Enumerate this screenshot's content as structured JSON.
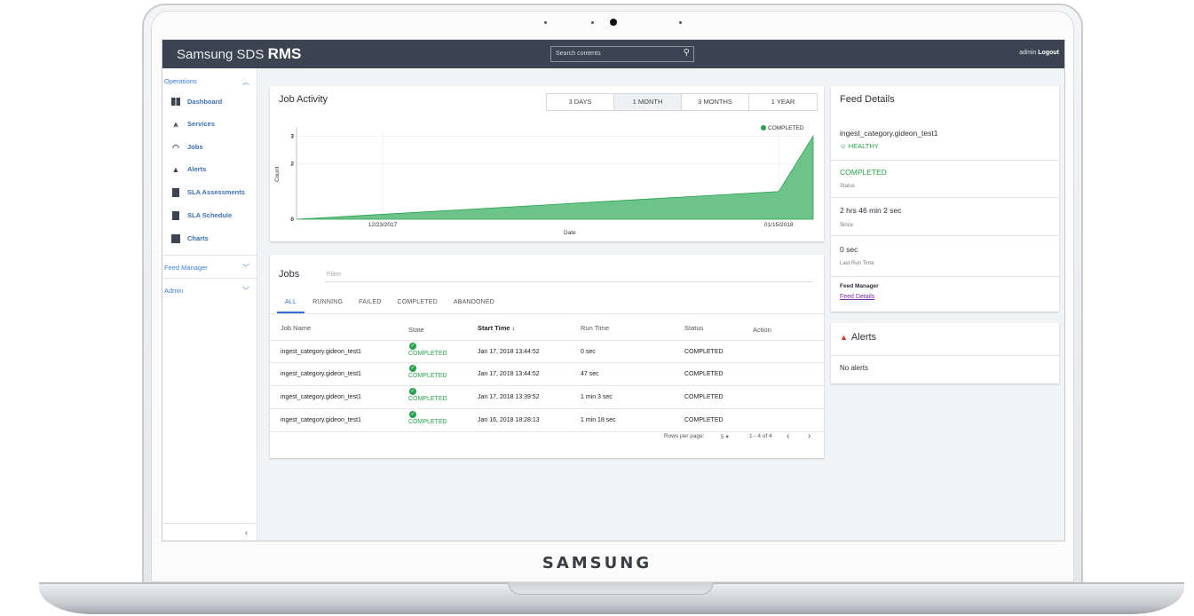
{
  "device": {
    "brand": "SAMSUNG"
  },
  "header": {
    "logo_prefix": "Samsung SDS",
    "logo_main": "RMS",
    "search_placeholder": "Search contents",
    "user": "admin",
    "logout_label": "Logout"
  },
  "sidebar": {
    "operations_label": "Operations",
    "items": [
      {
        "label": "Dashboard",
        "icon": "dashboard-icon"
      },
      {
        "label": "Services",
        "icon": "services-icon"
      },
      {
        "label": "Jobs",
        "icon": "jobs-icon"
      },
      {
        "label": "Alerts",
        "icon": "bell-icon"
      },
      {
        "label": "SLA Assessments",
        "icon": "clipboard-icon"
      },
      {
        "label": "SLA Schedule",
        "icon": "schedule-icon"
      },
      {
        "label": "Charts",
        "icon": "chart-icon"
      }
    ],
    "feed_manager_label": "Feed Manager",
    "admin_label": "Admin",
    "collapse_glyph": "‹"
  },
  "job_activity": {
    "title": "Job Activity",
    "ranges": [
      "3 DAYS",
      "1 MONTH",
      "3 MONTHS",
      "1 YEAR"
    ],
    "active_range": "1 MONTH"
  },
  "chart_data": {
    "type": "area",
    "title": "Job Activity",
    "xlabel": "Date",
    "ylabel": "Count",
    "x_tick_labels": [
      "12/23/2017",
      "01/15/2018"
    ],
    "y_ticks": [
      0,
      2,
      3
    ],
    "ylim": [
      0,
      3.2
    ],
    "series": [
      {
        "name": "COMPLETED",
        "color": "#27a24b",
        "fill": "#6cc48a",
        "x": [
          "12/18/2017",
          "01/15/2018",
          "01/17/2018"
        ],
        "values": [
          0,
          1,
          3
        ]
      }
    ],
    "grid": true,
    "legend": "top-right"
  },
  "jobs": {
    "title": "Jobs",
    "filter_placeholder": "Filter",
    "tabs": [
      "ALL",
      "RUNNING",
      "FAILED",
      "COMPLETED",
      "ABANDONED"
    ],
    "active_tab": "ALL",
    "columns": [
      "Job Name",
      "State",
      "Start Time",
      "Run Time",
      "Status",
      "Action"
    ],
    "sort_glyph": "↓",
    "rows": [
      {
        "name": "ingest_category.gideon_test1",
        "state": "COMPLETED",
        "start": "Jan 17, 2018 13:44:52",
        "run": "0 sec",
        "status": "COMPLETED"
      },
      {
        "name": "ingest_category.gideon_test1",
        "state": "COMPLETED",
        "start": "Jan 17, 2018 13:44:52",
        "run": "47 sec",
        "status": "COMPLETED"
      },
      {
        "name": "ingest_category.gideon_test1",
        "state": "COMPLETED",
        "start": "Jan 17, 2018 13:39:52",
        "run": "1 min 3 sec",
        "status": "COMPLETED"
      },
      {
        "name": "ingest_category.gideon_test1",
        "state": "COMPLETED",
        "start": "Jan 16, 2018 18:28:13",
        "run": "1 min 18 sec",
        "status": "COMPLETED"
      }
    ],
    "rows_per_page_label": "Rows per page:",
    "rows_per_page": "5",
    "range_text": "1 - 4 of 4",
    "prev_glyph": "‹",
    "next_glyph": "›"
  },
  "feed_details": {
    "title": "Feed Details",
    "feed_name": "ingest_category.gideon_test1",
    "health": "HEALTHY",
    "status_value": "COMPLETED",
    "status_label": "Status",
    "since_value": "2 hrs 46 min 2 sec",
    "since_label": "Since",
    "last_run_value": "0 sec",
    "last_run_label": "Last Run Time",
    "feed_manager_label": "Feed Manager",
    "feed_details_link": "Feed Details"
  },
  "alerts": {
    "title": "Alerts",
    "empty_text": "No alerts"
  }
}
